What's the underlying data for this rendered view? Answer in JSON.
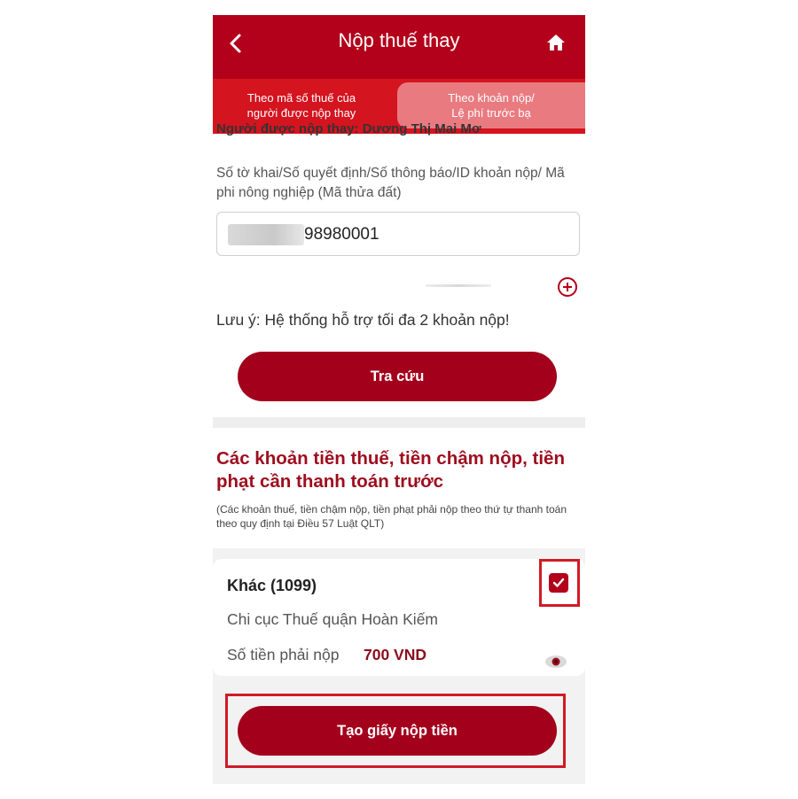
{
  "header": {
    "title": "Nộp thuế thay",
    "back_icon": "chevron-left-icon",
    "home_icon": "home-icon"
  },
  "tabs": [
    {
      "label_line1": "Theo mã số thuế của",
      "label_line2": "người được nộp thay",
      "active": false
    },
    {
      "label_line1": "Theo khoản nộp/",
      "label_line2": "Lệ phí trước bạ",
      "active": true
    }
  ],
  "cut_off_text": "Người được nộp thay: Dương Thị Mai Mơ",
  "form": {
    "field_label": "Số tờ khai/Số quyết định/Số thông báo/ID khoản nộp/ Mã phi nông nghiệp (Mã thửa đất)",
    "field_value": "98980001",
    "add_icon": "plus-circle-icon",
    "note": "Lưu ý: Hệ thống hỗ trợ tối đa 2 khoản nộp!",
    "search_label": "Tra cứu"
  },
  "payables": {
    "title": "Các khoản tiền thuế, tiền chậm nộp, tiền phạt cần thanh toán trước",
    "subtitle": "(Các khoản thuế, tiền chậm nộp, tiền phạt phải nộp theo thứ tự thanh toán theo quy định tại Điều 57 Luật QLT)",
    "item": {
      "title": "Khác (1099)",
      "office": "Chi cục Thuế quận Hoàn Kiếm",
      "amount_label": "Số tiền phải nộp",
      "amount": "700 VND",
      "checked": true,
      "eye_icon": "eye-icon"
    },
    "create_label": "Tạo giấy nộp tiền"
  },
  "colors": {
    "header": "#b3001b",
    "tab_bar": "#d4141f",
    "button": "#a3001c",
    "heading": "#9e0d1e",
    "highlight": "#d11a24"
  }
}
